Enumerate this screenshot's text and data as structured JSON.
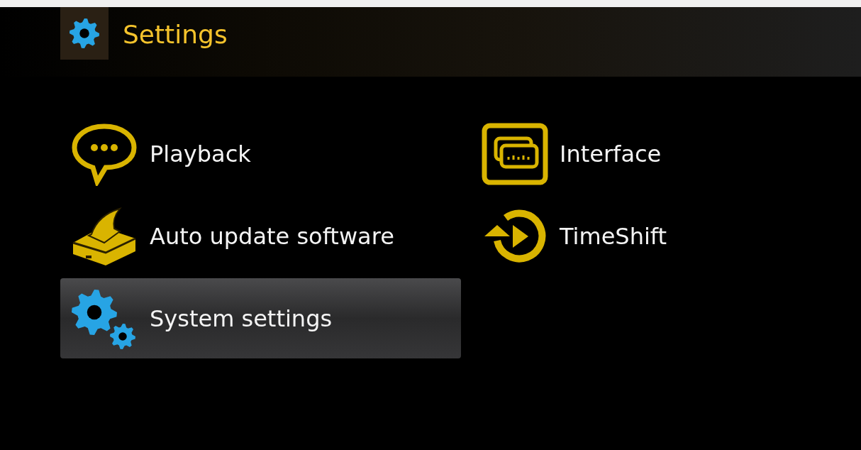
{
  "header": {
    "title": "Settings"
  },
  "menu": [
    {
      "label": "Playback",
      "kind": "chat",
      "selected": false
    },
    {
      "label": "Interface",
      "kind": "screens",
      "selected": false
    },
    {
      "label": "Auto update software",
      "kind": "box",
      "selected": false
    },
    {
      "label": "TimeShift",
      "kind": "replay",
      "selected": false
    },
    {
      "label": "System settings",
      "kind": "gears",
      "selected": true
    }
  ]
}
